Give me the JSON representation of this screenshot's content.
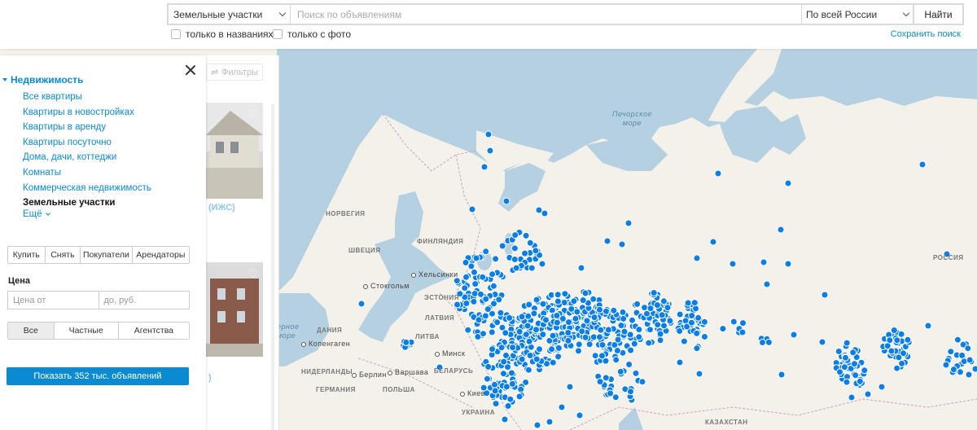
{
  "header": {
    "category_select": "Земельные участки",
    "search_placeholder": "Поиск по объявлениям",
    "region_select": "По всей России",
    "find_button": "Найти",
    "check_titles": "только в названиях",
    "check_photo": "только с фото",
    "save_search": "Сохранить поиск"
  },
  "sidebar": {
    "category_head": "Недвижимость",
    "items": [
      {
        "label": "Все квартиры",
        "active": false
      },
      {
        "label": "Квартиры в новостройках",
        "active": false
      },
      {
        "label": "Квартиры в аренду",
        "active": false
      },
      {
        "label": "Квартиры посуточно",
        "active": false
      },
      {
        "label": "Дома, дачи, коттеджи",
        "active": false
      },
      {
        "label": "Комнаты",
        "active": false
      },
      {
        "label": "Коммерческая недвижимость",
        "active": false
      },
      {
        "label": "Земельные участки",
        "active": true
      }
    ],
    "more": "Ещё",
    "deal_tabs": [
      "Купить",
      "Снять",
      "Покупатели",
      "Арендаторы"
    ],
    "price_label": "Цена",
    "price_from_placeholder": "Цена от",
    "price_to_placeholder": "до, руб.",
    "owner_tabs": [
      "Все",
      "Частные",
      "Агентства"
    ],
    "owner_selected": "Все",
    "show_button": "Показать 352 тыс. объявлений"
  },
  "listpane": {
    "filters": "Фильтры",
    "listing1_title": "(ИЖС)",
    "listing2_title": ")"
  },
  "map": {
    "water_color": "#b5d0e0",
    "land_color": "#f4f1ea",
    "marker_color": "#0a7ee6",
    "labels": {
      "pechora_sea": "Печорское\nморе",
      "norway": "НОРВЕГИЯ",
      "sweden": "ШВЕЦИЯ",
      "finland": "ФИНЛЯНДИЯ",
      "helsinki": "Хельсинки",
      "stockholm": "Стокгольм",
      "estonia": "ЭСТОНИЯ",
      "latvia": "ЛАТВИЯ",
      "lithuania": "ЛИТВА",
      "denmark": "ДАНИЯ",
      "copenhagen": "Копенгаген",
      "north_sea": "ерное\nморе",
      "minsk": "Минск",
      "belarus": "БЕЛАРУСЬ",
      "berlin": "Берлин",
      "warsaw": "Варшава",
      "netherlands": "НИДЕРЛАНДЫ",
      "germany": "ГЕРМАНИЯ",
      "poland": "ПОЛЬША",
      "kyiv": "Киев",
      "ukraine": "УКРАИНА",
      "kazakhstan": "КАЗАХСТАН",
      "russia": "РОССИЯ"
    }
  }
}
